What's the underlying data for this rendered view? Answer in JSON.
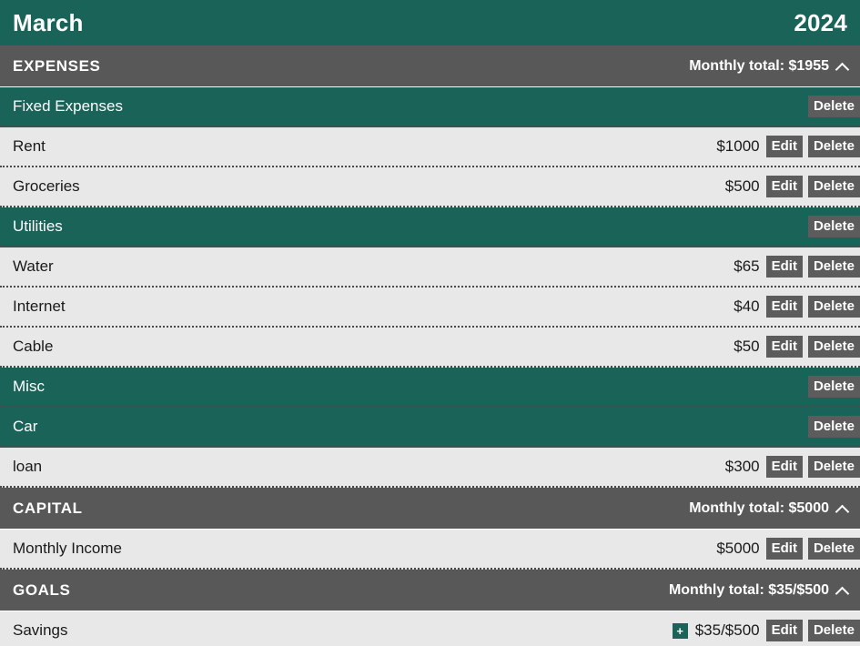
{
  "header": {
    "month": "March",
    "year": "2024"
  },
  "labels": {
    "edit": "Edit",
    "delete": "Delete",
    "add": "+",
    "collapse_icon": "chevron-up"
  },
  "sections": [
    {
      "title": "EXPENSES",
      "total_label": "Monthly total: $1955",
      "rows": [
        {
          "type": "category",
          "name": "Fixed Expenses"
        },
        {
          "type": "item",
          "name": "Rent",
          "amount": "$1000"
        },
        {
          "type": "item",
          "name": "Groceries",
          "amount": "$500"
        },
        {
          "type": "category",
          "name": "Utilities"
        },
        {
          "type": "item",
          "name": "Water",
          "amount": "$65"
        },
        {
          "type": "item",
          "name": "Internet",
          "amount": "$40"
        },
        {
          "type": "item",
          "name": "Cable",
          "amount": "$50"
        },
        {
          "type": "category",
          "name": "Misc"
        },
        {
          "type": "category",
          "name": "Car"
        },
        {
          "type": "item",
          "name": "loan",
          "amount": "$300"
        }
      ]
    },
    {
      "title": "CAPITAL",
      "total_label": "Monthly total: $5000",
      "rows": [
        {
          "type": "item",
          "name": "Monthly Income",
          "amount": "$5000"
        }
      ]
    },
    {
      "title": "GOALS",
      "total_label": "Monthly total: $35/$500",
      "rows": [
        {
          "type": "item",
          "name": "Savings",
          "amount": "$35/$500",
          "has_add": true
        }
      ]
    }
  ],
  "colors": {
    "teal": "#1a6359",
    "gray_bar": "#585858",
    "row_light": "#e8e8e8",
    "button_gray": "#5c5c5c"
  }
}
